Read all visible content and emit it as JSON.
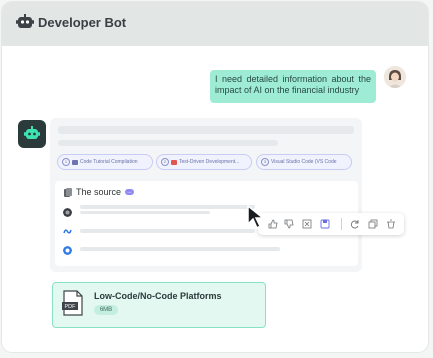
{
  "header": {
    "title": "Developer Bot",
    "icon": "robot-icon"
  },
  "user_message": {
    "text": "I need detailed information about the impact of AI on the financial industry"
  },
  "bot_message": {
    "chips": [
      {
        "num": "1",
        "icon": "doc-icon",
        "label": "Code Tutorial Compilation"
      },
      {
        "num": "2",
        "icon": "pdf-icon",
        "label": "Test-Driven Development..."
      },
      {
        "num": "3",
        "icon": "",
        "label": "Visual Studio Code (VS Code"
      }
    ],
    "sources": {
      "title": "The source",
      "badge": "..."
    }
  },
  "toolbar_icons": [
    "thumbs-up-icon",
    "thumbs-down-icon",
    "screenshot-icon",
    "save-icon",
    "refresh-icon",
    "copy-icon",
    "delete-icon"
  ],
  "file": {
    "name": "Low-Code/No-Code Platforms",
    "size": "6MB",
    "type_label": "PDF"
  },
  "colors": {
    "accent": "#9eecd4",
    "file_bg": "#e3f8f1",
    "badge": "#8f8bf0"
  }
}
